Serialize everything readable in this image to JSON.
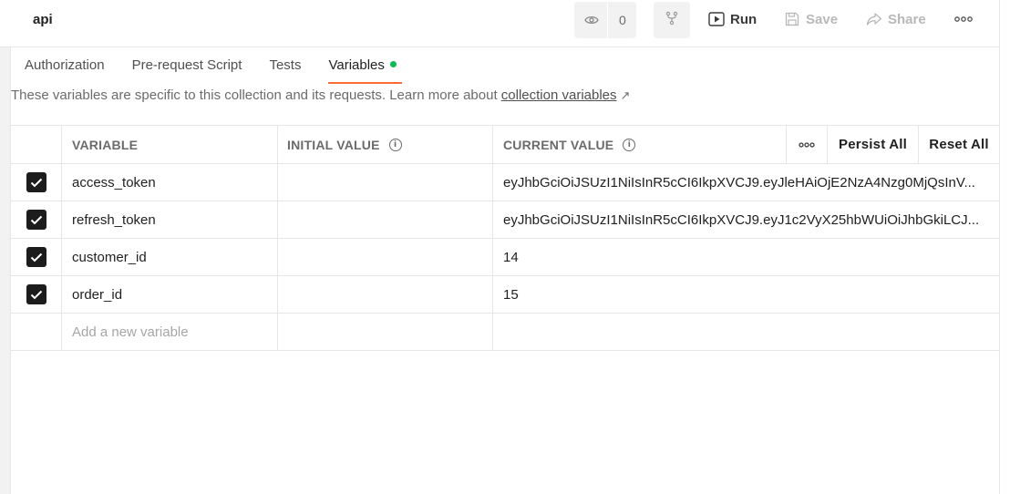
{
  "collection": {
    "title": "api"
  },
  "toolbar": {
    "watch_count": "0",
    "run_label": "Run",
    "save_label": "Save",
    "share_label": "Share"
  },
  "tabs": [
    {
      "label": "Authorization"
    },
    {
      "label": "Pre-request Script"
    },
    {
      "label": "Tests"
    },
    {
      "label": "Variables"
    }
  ],
  "description": {
    "text": "These variables are specific to this collection and its requests. Learn more about ",
    "link": "collection variables",
    "arrow": "↗"
  },
  "table": {
    "columns": {
      "variable": "VARIABLE",
      "initial_value": "INITIAL VALUE",
      "current_value": "CURRENT VALUE",
      "persist_all": "Persist All",
      "reset_all": "Reset All"
    },
    "rows": [
      {
        "variable": "access_token",
        "initial_value": "",
        "current_value": "eyJhbGciOiJSUzI1NiIsInR5cCI6IkpXVCJ9.eyJleHAiOjE2NzA4Nzg0MjQsInV...",
        "checked": true
      },
      {
        "variable": "refresh_token",
        "initial_value": "",
        "current_value": "eyJhbGciOiJSUzI1NiIsInR5cCI6IkpXVCJ9.eyJ1c2VyX25hbWUiOiJhbGkiLCJ...",
        "checked": true
      },
      {
        "variable": "customer_id",
        "initial_value": "",
        "current_value": "14",
        "checked": true
      },
      {
        "variable": "order_id",
        "initial_value": "",
        "current_value": "15",
        "checked": true
      }
    ],
    "new_row_placeholder": "Add a new variable"
  },
  "colors": {
    "accent": "#ff6c37",
    "status_dot": "#0cbb52"
  }
}
